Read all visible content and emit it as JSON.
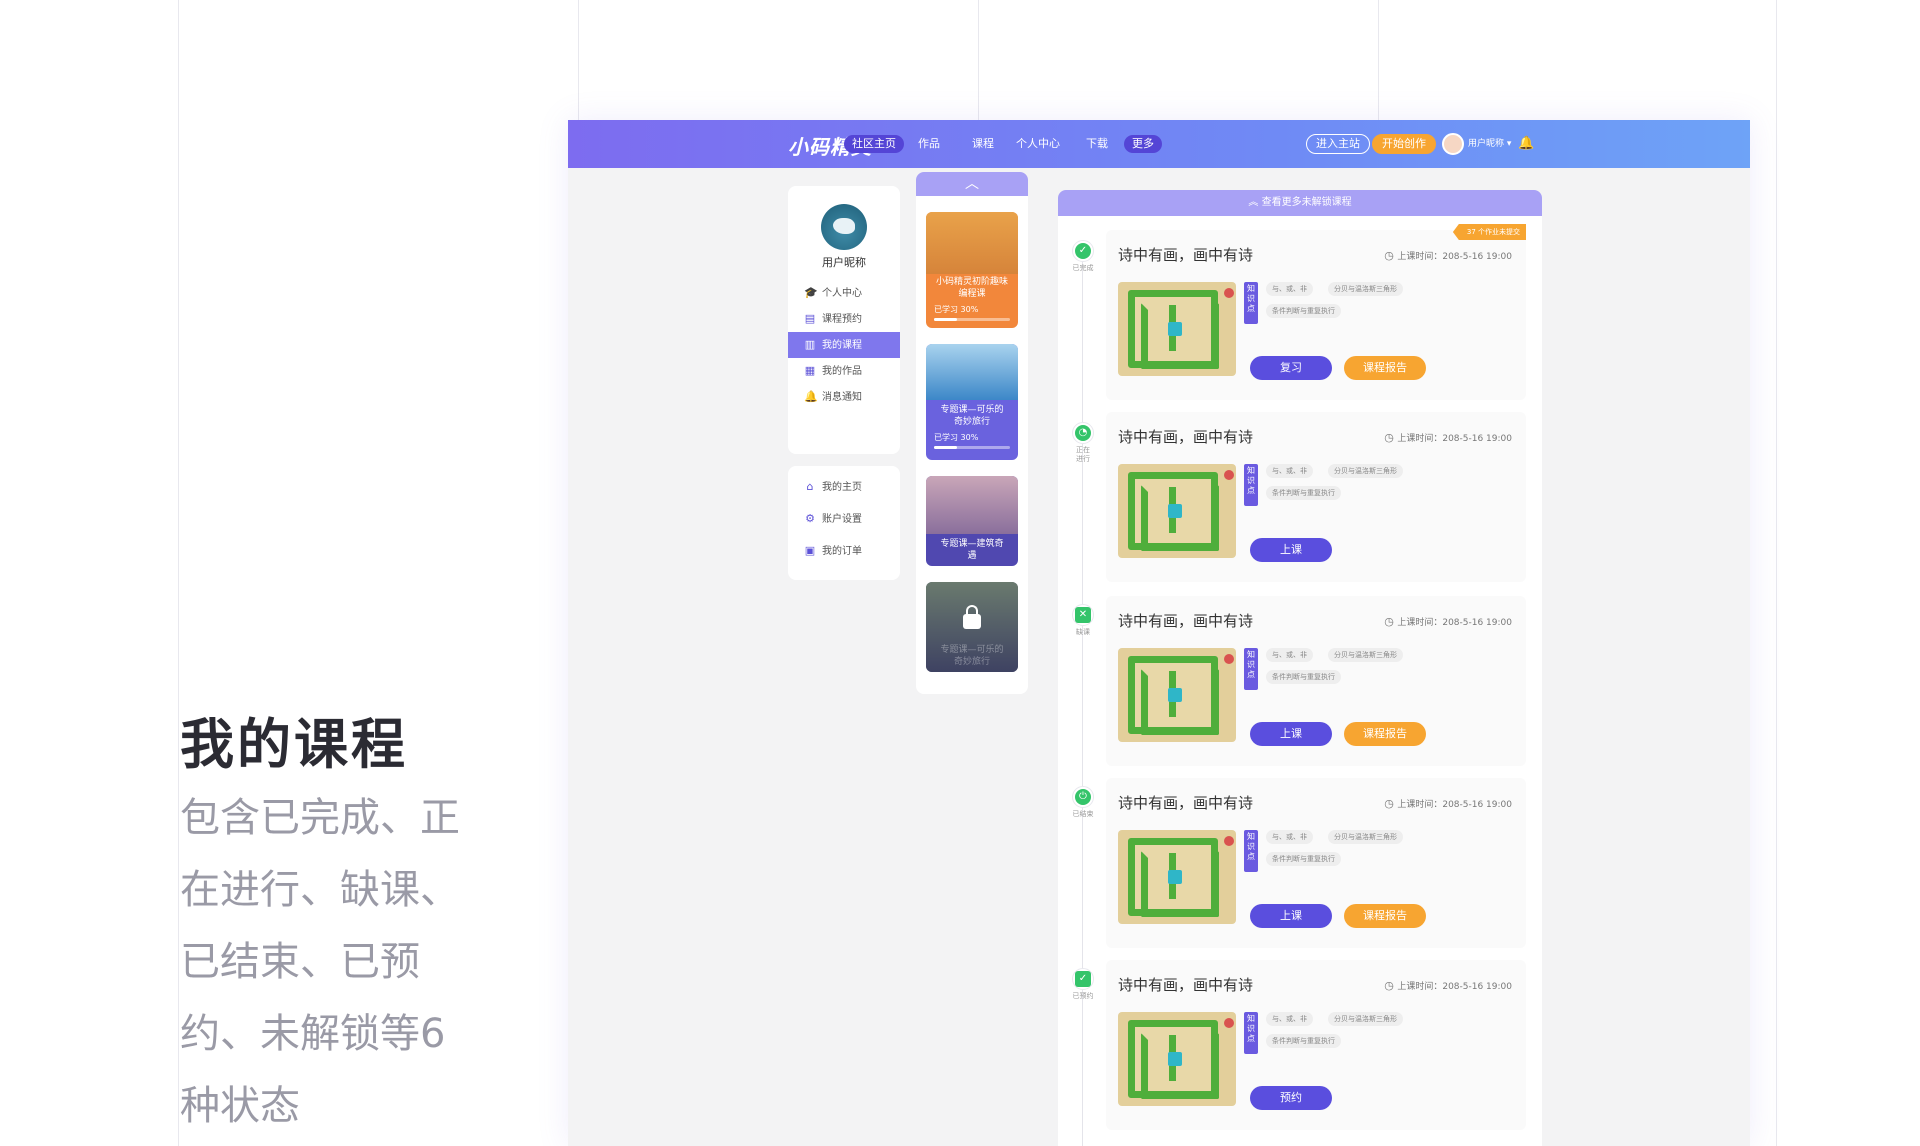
{
  "intro": {
    "title": "我的课程",
    "desc": "包含已完成、正在进行、缺课、已结束、已预约、未解锁等6种状态"
  },
  "header": {
    "logo": "小码精灵",
    "nav": [
      "社区主页",
      "作品",
      "课程",
      "个人中心",
      "下载",
      "更多"
    ],
    "active_nav": "社区主页",
    "enter_station": "进入主站",
    "start_create": "开始创作",
    "username": "用户昵称 ▾",
    "bell_icon": "bell-icon"
  },
  "sidebar": {
    "username": "用户昵称",
    "menu": [
      {
        "label": "个人中心",
        "icon": "graduation-cap-icon",
        "glyph": "🎓"
      },
      {
        "label": "课程预约",
        "icon": "calendar-list-icon",
        "glyph": "▤"
      },
      {
        "label": "我的课程",
        "icon": "book-icon",
        "glyph": "▥"
      },
      {
        "label": "我的作品",
        "icon": "artwork-icon",
        "glyph": "▦"
      },
      {
        "label": "消息通知",
        "icon": "bell-icon",
        "glyph": "🔔"
      }
    ],
    "menu2": [
      {
        "label": "我的主页",
        "icon": "home-icon",
        "glyph": "⌂"
      },
      {
        "label": "账户设置",
        "icon": "gear-icon",
        "glyph": "⚙"
      },
      {
        "label": "我的订单",
        "icon": "clipboard-icon",
        "glyph": "▣"
      }
    ],
    "active": "我的课程"
  },
  "course_cards": {
    "up_icon": "chevron-up-icon",
    "cards": [
      {
        "title": "小码精灵初阶趣味编程课",
        "progress_label": "已学习 30%",
        "progress": 0.3,
        "color": "#f2873b"
      },
      {
        "title": "专题课—可乐的奇妙旅行",
        "progress_label": "已学习 30%",
        "progress": 0.3,
        "color": "#6a62de"
      },
      {
        "title": "专题课—建筑奇遇",
        "color": "#5048b0"
      },
      {
        "title": "专题课—可乐的奇妙旅行",
        "locked": true,
        "color": "#4b4f6e"
      }
    ]
  },
  "main": {
    "head_label": "查看更多未解锁课程",
    "badge": "37 个作业未提交",
    "items": [
      {
        "status": "已完成",
        "status_glyph": "✓",
        "status_color": "#34c46a",
        "title": "诗中有画，画中有诗",
        "time": "上课时间：208-5-16 19:00",
        "kp": "知识点",
        "tags": [
          "与、或、非",
          "分贝与温洛斯三角形",
          "条件判断与重复执行"
        ],
        "btn1": "复习",
        "btn2": "课程报告"
      },
      {
        "status": "正在进行",
        "status_glyph": "◔",
        "status_color": "#34c46a",
        "title": "诗中有画，画中有诗",
        "time": "上课时间：208-5-16 19:00",
        "kp": "知识点",
        "tags": [
          "与、或、非",
          "分贝与温洛斯三角形",
          "条件判断与重复执行"
        ],
        "btn1": "上课"
      },
      {
        "status": "缺课",
        "status_glyph": "✕",
        "status_color": "#34c46a",
        "title": "诗中有画，画中有诗",
        "time": "上课时间：208-5-16 19:00",
        "kp": "知识点",
        "tags": [
          "与、或、非",
          "分贝与温洛斯三角形",
          "条件判断与重复执行"
        ],
        "btn1": "上课",
        "btn2": "课程报告"
      },
      {
        "status": "已结束",
        "status_glyph": "⏻",
        "status_color": "#34c46a",
        "title": "诗中有画，画中有诗",
        "time": "上课时间：208-5-16 19:00",
        "kp": "知识点",
        "tags": [
          "与、或、非",
          "分贝与温洛斯三角形",
          "条件判断与重复执行"
        ],
        "btn1": "上课",
        "btn2": "课程报告"
      },
      {
        "status": "已预约",
        "status_glyph": "✓",
        "status_color": "#34c46a",
        "title": "诗中有画，画中有诗",
        "time": "上课时间：208-5-16 19:00",
        "kp": "知识点",
        "tags": [
          "与、或、非",
          "分贝与温洛斯三角形",
          "条件判断与重复执行"
        ],
        "btn1": "预约"
      }
    ]
  }
}
